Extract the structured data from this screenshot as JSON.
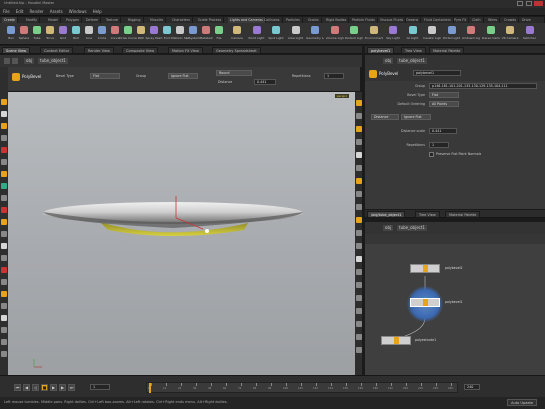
{
  "window": {
    "title": "Untitled.hip - Houdini Master"
  },
  "menu": [
    "File",
    "Edit",
    "Render",
    "Assets",
    "Windows",
    "Help"
  ],
  "desktop": "Build",
  "shelf": {
    "tabs_left": [
      "Create",
      "Modify",
      "Model",
      "Polygon",
      "Deform",
      "Texture",
      "Rigging",
      "Muscles",
      "Characters",
      "Guide Process",
      "Guide Brushes",
      "Terrain FX"
    ],
    "tabs_right": [
      "Lights and Cameras",
      "Collisions",
      "Particles",
      "Grains",
      "Rigid Bodies",
      "Particle Fluids",
      "Viscous Fluids",
      "Oceans",
      "Fluid Containers",
      "Populate Containers",
      "Container Tools",
      "Pyro FX",
      "Cloth",
      "Solid",
      "Wires",
      "Crowds",
      "Drive Simulation"
    ],
    "tools_left": [
      "Box",
      "Sphere",
      "Tube",
      "Torus",
      "Grid",
      "Null",
      "Line",
      "Circle",
      "Curve",
      "Draw Curve",
      "Path",
      "Spray Paint",
      "Font",
      "Platonic Solids",
      "L-System",
      "Metaball",
      "File"
    ],
    "tools_right": [
      "Camera",
      "Point Light",
      "Spot Light",
      "Area Light",
      "Geometry Light",
      "Volume Light",
      "Distant Light",
      "Environment Light",
      "Sky Light",
      "GI Light",
      "Caustic Light",
      "Portal Light",
      "Ambient Light",
      "Stereo Camera",
      "VR Camera",
      "Switcher"
    ]
  },
  "left_pane_tabs": [
    "Scene View",
    "Context Editor",
    "Render View",
    "Composite View",
    "Motion FX View",
    "Geometry Spreadsheet"
  ],
  "viewer": {
    "path": [
      "obj",
      "tube_object1"
    ],
    "op_name": "PolyBevel",
    "bevel_type_label": "Bevel Type",
    "bevel_type": "Flat",
    "group_label": "Group",
    "ignore_flat": "Ignore Flat",
    "repetitions_label": "Repetitions",
    "repetitions": "1",
    "divide_label": "Divide",
    "divide_mode": "Round",
    "distance_label": "Distance",
    "distance_value": "0.441",
    "camera": "persp1"
  },
  "right_pane_tabs": [
    "polybevel1",
    "Tree View",
    "Material Palette"
  ],
  "params": {
    "op_type": "PolyBevel",
    "op_name": "polybevel1",
    "group_label": "Group",
    "group_value": "p146-181-101-201-135-130-129-135-104-111",
    "bevel_type_label": "Bevel Type",
    "bevel_type": "Flat",
    "default_label": "Default Ordering",
    "default_value": "All Points",
    "section_a": "Distance",
    "section_b": "Ignore Flat",
    "distance_label": "Distance scale",
    "distance_value": "0.441",
    "repetitions_label": "Repetitions",
    "repetitions_value": "1",
    "checkbox_label": "Preserve Flat Point Normals"
  },
  "network": {
    "tabs": [
      "/obj/tube_object1",
      "Tree View",
      "Material Palette"
    ],
    "path": [
      "obj",
      "tube_object1"
    ],
    "nodes": [
      {
        "name": "polybevel1"
      },
      {
        "name": "polybevel2"
      },
      {
        "name": "polyextrude1"
      }
    ]
  },
  "timeline": {
    "start": "1",
    "frame": "1",
    "end": "240",
    "ticks": [
      "1",
      "12",
      "24",
      "36",
      "48",
      "60",
      "72",
      "84",
      "96",
      "108",
      "120",
      "132",
      "144",
      "156",
      "168",
      "180",
      "192",
      "204",
      "216",
      "228",
      "240"
    ]
  },
  "status": {
    "message": "Left mouse tumbles. Middle pans. Right dollies. Ctrl+Left box-zooms. Alt+Left rotates. Ctrl+Right ends menu. Alt+Right dollies.",
    "right": "Auto Update"
  },
  "colors": {
    "accent": "#e7a319",
    "node_blue": "#3a68b0",
    "base_yellow": "#c8c030",
    "viewport_bg": "#a7aaae"
  }
}
